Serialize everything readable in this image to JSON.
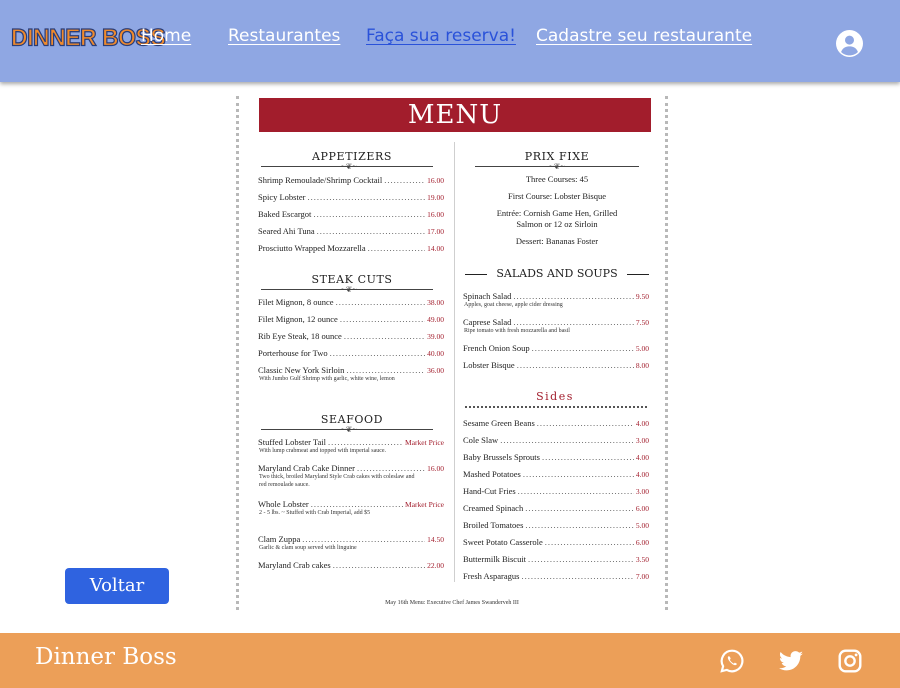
{
  "nav": {
    "logo": "DINNER BOSS",
    "links": [
      "Home",
      "Restaurantes",
      "Faça sua reserva!",
      "Cadastre seu restaurante"
    ],
    "user_icon": "user-circle-icon"
  },
  "menu": {
    "title": "MENU",
    "appetizers": {
      "title": "APPETIZERS",
      "items": [
        {
          "name": "Shrimp Remoulade/Shrimp Cocktail",
          "price": "16.00"
        },
        {
          "name": "Spicy Lobster",
          "price": "19.00"
        },
        {
          "name": "Baked Escargot",
          "price": "16.00"
        },
        {
          "name": "Seared Ahi Tuna",
          "price": "17.00"
        },
        {
          "name": "Prosciutto Wrapped Mozzarella",
          "price": "14.00"
        }
      ]
    },
    "steak": {
      "title": "STEAK CUTS",
      "items": [
        {
          "name": "Filet Mignon, 8 ounce",
          "price": "38.00"
        },
        {
          "name": "Filet Mignon, 12 ounce",
          "price": "49.00"
        },
        {
          "name": "Rib Eye Steak, 18 ounce",
          "price": "39.00"
        },
        {
          "name": "Porterhouse for Two",
          "price": "40.00"
        },
        {
          "name": "Classic New York Sirloin",
          "price": "36.00",
          "desc": "With Jumbo Gulf Shrimp with garlic, white wine, lemon"
        }
      ]
    },
    "seafood": {
      "title": "SEAFOOD",
      "items": [
        {
          "name": "Stuffed Lobster Tail",
          "price": "Market Price",
          "desc": "With lump crabmeat and topped with imperial sauce."
        },
        {
          "name": "Maryland Crab Cake Dinner",
          "price": "16.00",
          "desc": "Two thick, broiled Maryland Style Crab cakes with coleslaw and red remoulade sauce."
        },
        {
          "name": "Whole Lobster",
          "price": "Market Price",
          "desc": "2 - 5 lbs. ~ Stuffed with Crab Imperial, add $5"
        },
        {
          "name": "Clam Zuppa",
          "price": "14.50",
          "desc": "Garlic & clam soup served with linguine"
        },
        {
          "name": "Maryland Crab cakes",
          "price": "22.00"
        }
      ]
    },
    "prix_fixe": {
      "title": "PRIX FIXE",
      "lines": [
        "Three Courses:  45",
        "First Course: Lobster Bisque",
        "Entrée: Cornish Game Hen, Grilled Salmon or 12 oz Sirloin",
        "Dessert: Bananas Foster"
      ]
    },
    "salads": {
      "title": "SALADS AND SOUPS",
      "items": [
        {
          "name": "Spinach Salad",
          "price": "9.50",
          "desc": "Apples, goat cheese, apple cider dressing"
        },
        {
          "name": "Caprese Salad",
          "price": "7.50",
          "desc": "Ripe tomato with fresh mozzarella and basil"
        },
        {
          "name": "French Onion Soup",
          "price": "5.00"
        },
        {
          "name": "Lobster Bisque",
          "price": "8.00"
        }
      ]
    },
    "sides": {
      "title": "Sides",
      "items": [
        {
          "name": "Sesame Green Beans",
          "price": "4.00"
        },
        {
          "name": "Cole Slaw",
          "price": "3.00"
        },
        {
          "name": "Baby Brussels Sprouts",
          "price": "4.00"
        },
        {
          "name": "Mashed Potatoes",
          "price": "4.00"
        },
        {
          "name": "Hand-Cut Fries",
          "price": "3.00"
        },
        {
          "name": "Creamed Spinach",
          "price": "6.00"
        },
        {
          "name": "Broiled Tomatoes",
          "price": "5.00"
        },
        {
          "name": "Sweet Potato Casserole",
          "price": "6.00"
        },
        {
          "name": "Buttermilk Biscuit",
          "price": "3.50"
        },
        {
          "name": "Fresh Asparagus",
          "price": "7.00"
        }
      ]
    },
    "footnote": "May 16th Menu: Executive Chef James Swanderveh III"
  },
  "voltar_label": "Voltar",
  "footer": {
    "brand": "Dinner Boss",
    "icons": [
      "whatsapp-icon",
      "twitter-icon",
      "instagram-icon"
    ]
  },
  "colors": {
    "nav": "#8fa7e3",
    "footer": "#ec9f58",
    "menu_red": "#a21d2c",
    "button": "#2f63e0",
    "active_link": "#2a52d9"
  }
}
